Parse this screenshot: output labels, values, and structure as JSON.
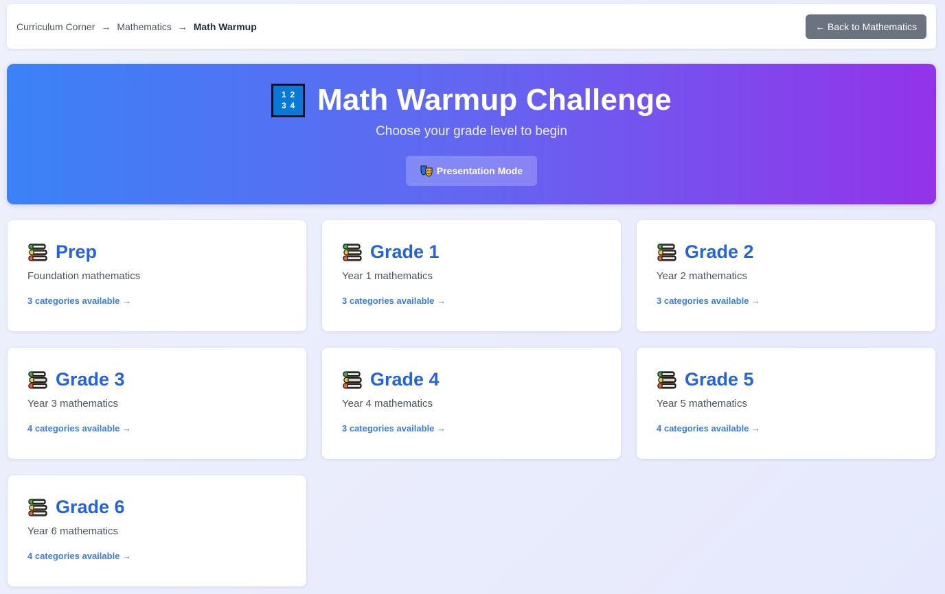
{
  "breadcrumb": {
    "items": [
      "Curriculum Corner",
      "Mathematics"
    ],
    "separator": "→",
    "current": "Math Warmup"
  },
  "back_button": {
    "label": "← Back to Mathematics"
  },
  "hero": {
    "icon": "input-numbers-icon",
    "icon_digits": [
      "1",
      "2",
      "3",
      "4"
    ],
    "title": "Math Warmup Challenge",
    "subtitle": "Choose your grade level to begin",
    "presentation_button": {
      "icon": "performing-arts-masks-icon",
      "label": "Presentation Mode"
    }
  },
  "grades": [
    {
      "title": "Prep",
      "description": "Foundation mathematics",
      "link": "3 categories available →",
      "icon": "books-icon"
    },
    {
      "title": "Grade 1",
      "description": "Year 1 mathematics",
      "link": "3 categories available →",
      "icon": "books-icon"
    },
    {
      "title": "Grade 2",
      "description": "Year 2 mathematics",
      "link": "3 categories available →",
      "icon": "books-icon"
    },
    {
      "title": "Grade 3",
      "description": "Year 3 mathematics",
      "link": "4 categories available →",
      "icon": "books-icon"
    },
    {
      "title": "Grade 4",
      "description": "Year 4 mathematics",
      "link": "3 categories available →",
      "icon": "books-icon"
    },
    {
      "title": "Grade 5",
      "description": "Year 5 mathematics",
      "link": "4 categories available →",
      "icon": "books-icon"
    },
    {
      "title": "Grade 6",
      "description": "Year 6 mathematics",
      "link": "4 categories available →",
      "icon": "books-icon"
    }
  ],
  "colors": {
    "hero_gradient_start": "#3b82f6",
    "hero_gradient_end": "#9333ea",
    "accent_blue": "#2563d9",
    "back_button_bg": "#6b7280"
  }
}
